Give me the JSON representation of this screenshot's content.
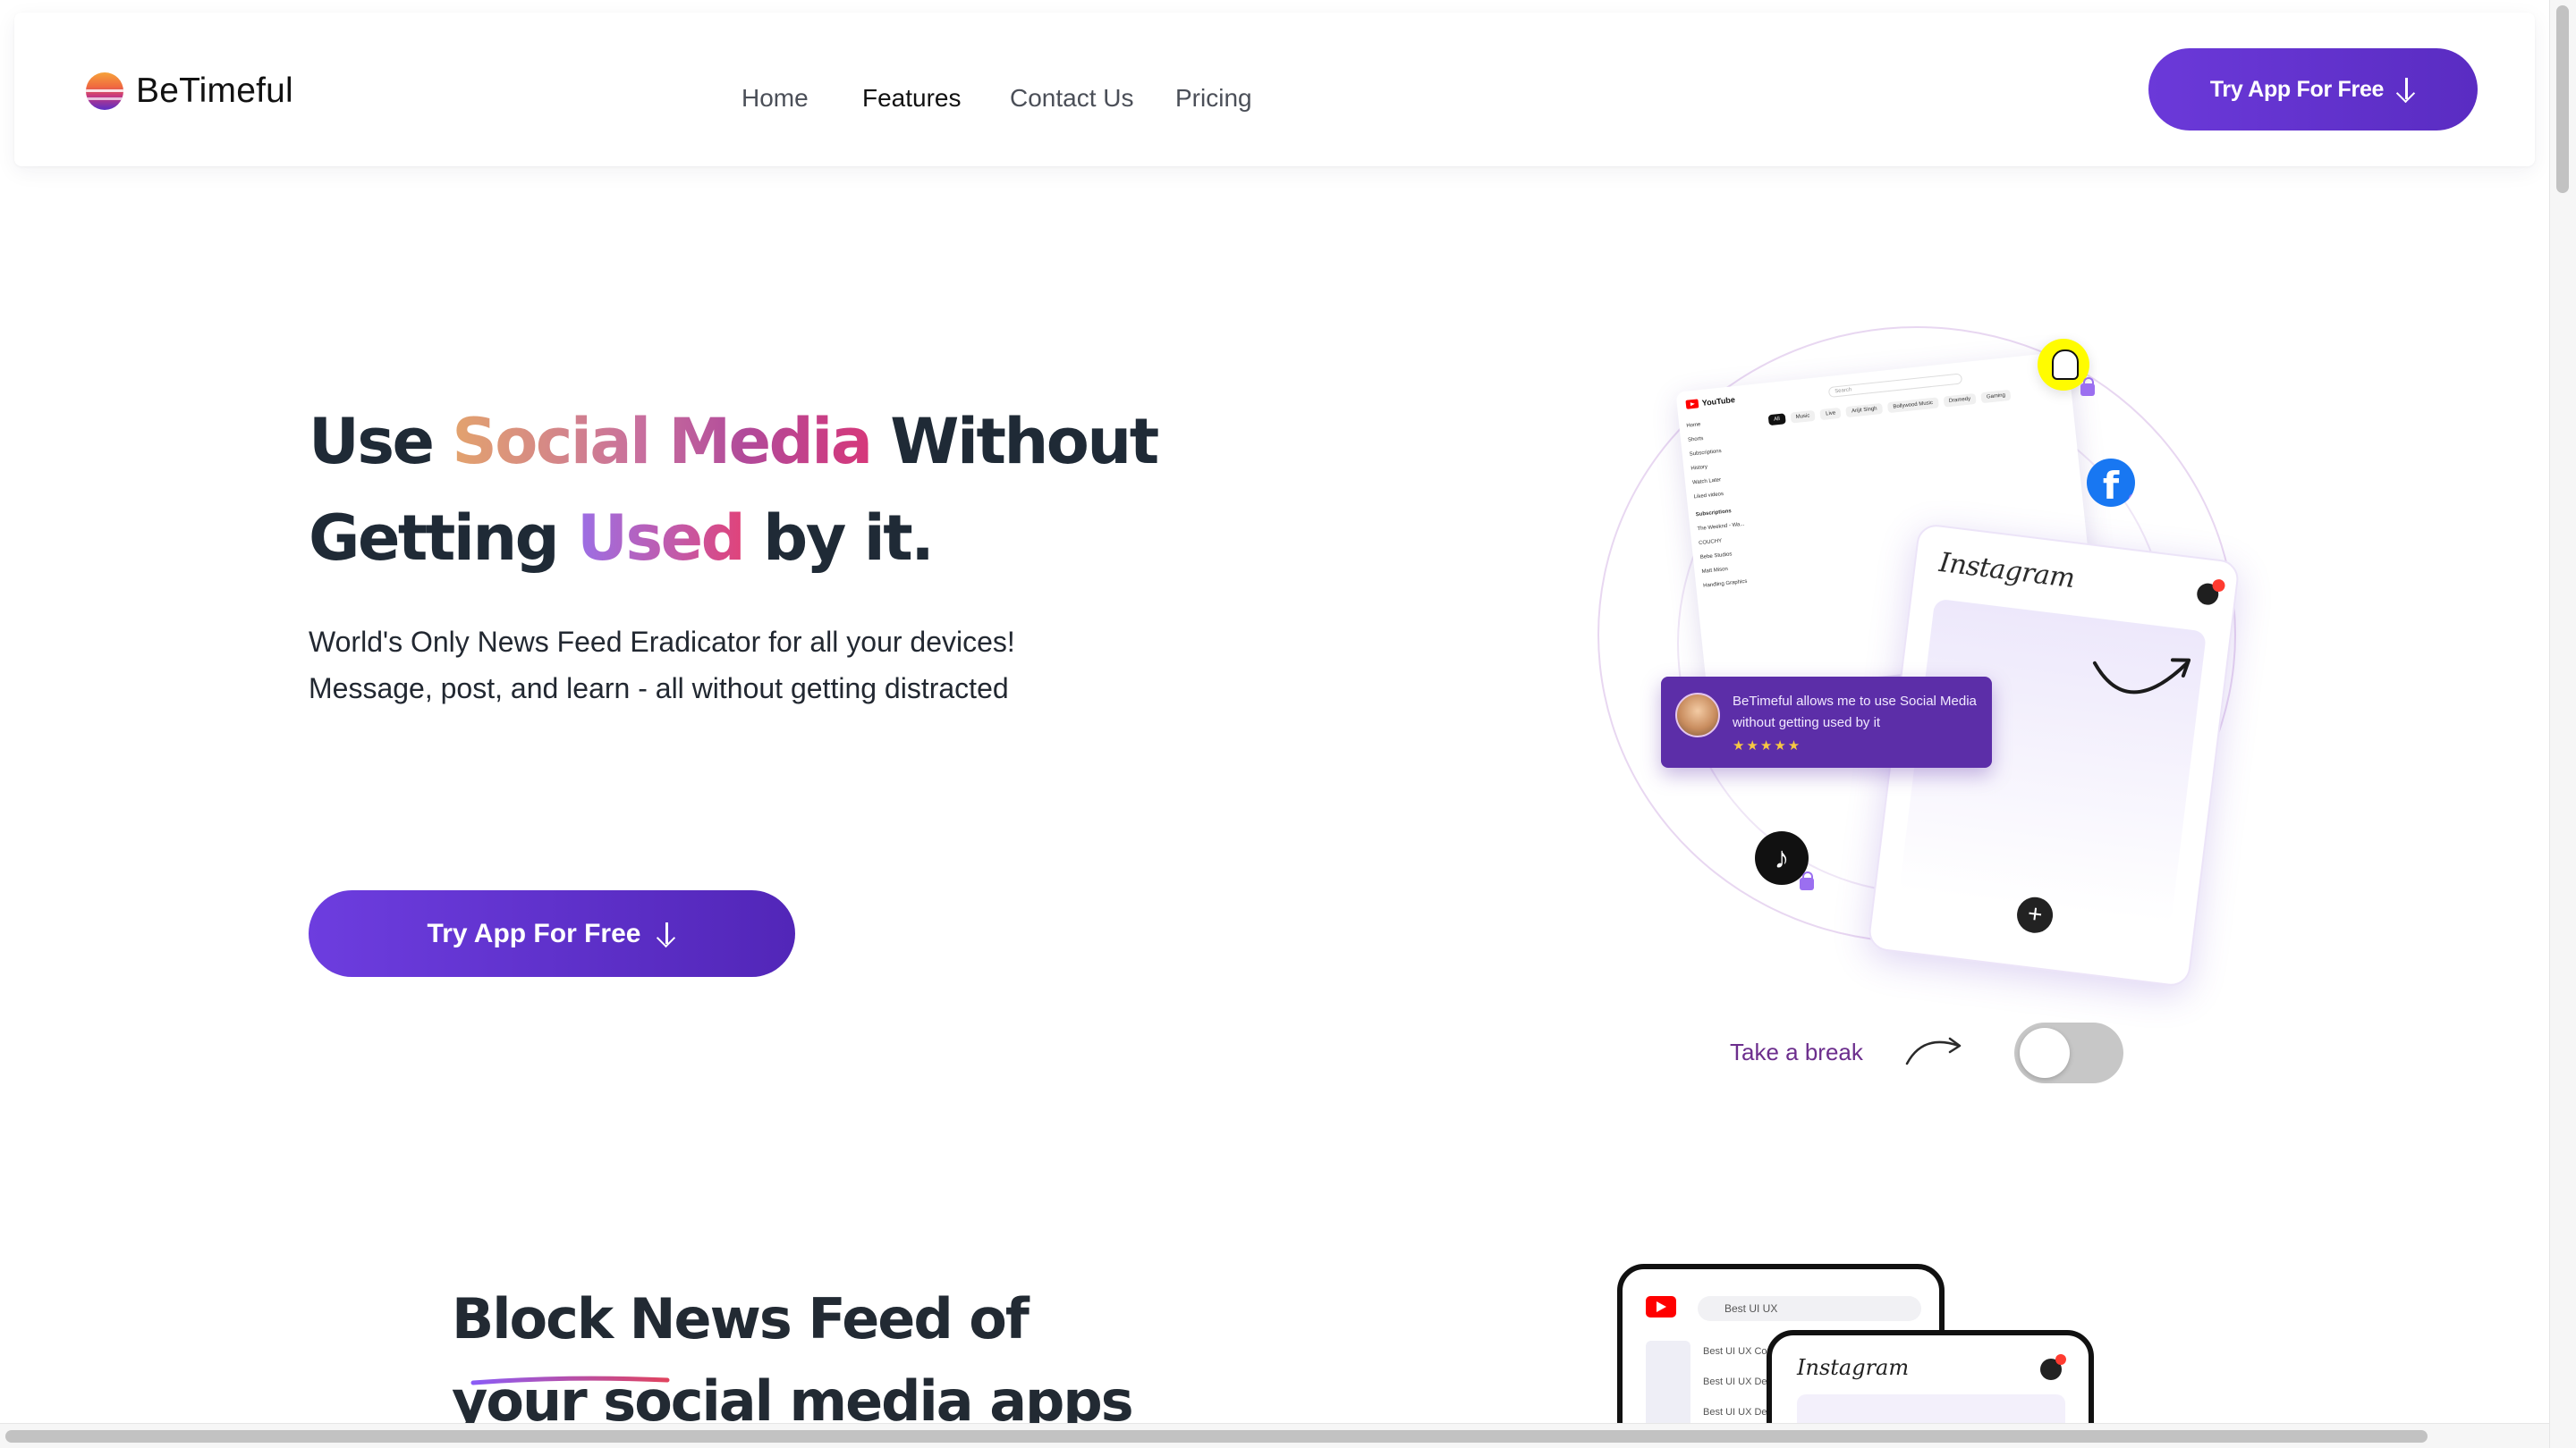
{
  "brand": {
    "name": "BeTimeful",
    "logo_icon": "sunset-logo-icon"
  },
  "nav": {
    "items": [
      {
        "label": "Home",
        "active": false
      },
      {
        "label": "Features",
        "active": true
      },
      {
        "label": "Contact Us",
        "active": false
      },
      {
        "label": "Pricing",
        "active": false
      }
    ],
    "cta_label": "Try App For Free"
  },
  "hero": {
    "title_line1": {
      "a": "Use ",
      "b": "Social Media",
      "c": " Without"
    },
    "title_line2": {
      "a": "Getting ",
      "b": "Used",
      "c": " by it."
    },
    "subtitle_line1": "World's Only News Feed Eradicator for all your devices!",
    "subtitle_line2": "Message, post, and learn - all without getting distracted",
    "cta_label": "Try App For Free"
  },
  "illustration": {
    "review_text": "BeTimeful allows me to use Social Media without getting used by it",
    "review_stars": "★★★★★",
    "instagram_wordmark": "Instagram",
    "youtube_wordmark": "YouTube",
    "youtube_search": "Search",
    "youtube_chips": [
      "All",
      "Music",
      "Live",
      "Arijit Singh",
      "Bollywood Music",
      "Dramedy",
      "Gaming"
    ],
    "youtube_side": [
      "Home",
      "Shorts",
      "Subscriptions",
      "History",
      "Watch Later",
      "Liked videos"
    ],
    "youtube_side_heading": "Subscriptions",
    "youtube_side_channels": [
      "The Weeknd - Wa...",
      "COUCHY",
      "Bebe Studios",
      "Matt Mison",
      "Handling Graphics"
    ],
    "icons": [
      "snapchat-icon",
      "facebook-icon",
      "tiktok-icon",
      "lock-icon"
    ]
  },
  "break_toggle": {
    "label": "Take a break",
    "on": false
  },
  "section2": {
    "title_line1": "Block News Feed of",
    "title_line2": "your social media apps",
    "phone1_search": "Best UI UX",
    "phone1_rows": [
      "Best UI UX Cou...",
      "Best UI UX De...",
      "Best UI UX De..."
    ],
    "phone2_wordmark": "Instagram"
  },
  "colors": {
    "primary": "#5a2cc2",
    "review_bg": "#5c2ea8",
    "break_label": "#6c2e8d",
    "toggle_off": "#c7c7c7"
  }
}
